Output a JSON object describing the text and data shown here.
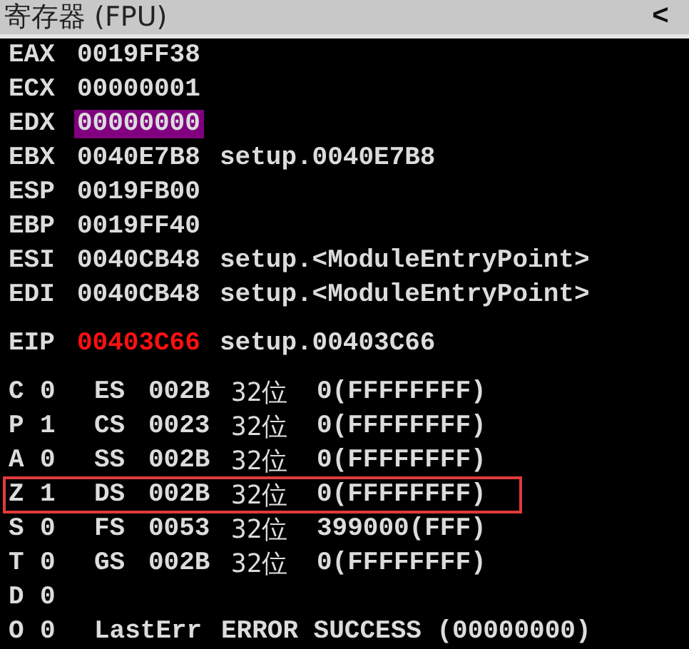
{
  "panel": {
    "title": "寄存器 (FPU)",
    "collapse_button": "<"
  },
  "register_groups": [
    [
      {
        "name": "EAX",
        "value": "0019FF38",
        "selected": false,
        "changed": false
      },
      {
        "name": "ECX",
        "value": "00000001",
        "selected": false,
        "changed": false
      },
      {
        "name": "EDX",
        "value": "00000000",
        "selected": true,
        "changed": false
      },
      {
        "name": "EBX",
        "value": "0040E7B8",
        "comment": "setup.0040E7B8",
        "selected": false,
        "changed": false
      },
      {
        "name": "ESP",
        "value": "0019FB00",
        "selected": false,
        "changed": false
      },
      {
        "name": "EBP",
        "value": "0019FF40",
        "selected": false,
        "changed": false
      },
      {
        "name": "ESI",
        "value": "0040CB48",
        "comment": "setup.<ModuleEntryPoint>",
        "selected": false,
        "changed": false
      },
      {
        "name": "EDI",
        "value": "0040CB48",
        "comment": "setup.<ModuleEntryPoint>",
        "selected": false,
        "changed": false
      }
    ],
    [
      {
        "name": "EIP",
        "value": "00403C66",
        "comment": "setup.00403C66",
        "selected": false,
        "changed": true
      }
    ]
  ],
  "flag_rows": [
    {
      "kind": "segment",
      "flag": "C",
      "value": "0",
      "segment": "ES",
      "selector": "002B",
      "bits": "32位",
      "base": "0(FFFFFFFF)",
      "boxed": false
    },
    {
      "kind": "segment",
      "flag": "P",
      "value": "1",
      "segment": "CS",
      "selector": "0023",
      "bits": "32位",
      "base": "0(FFFFFFFF)",
      "boxed": false
    },
    {
      "kind": "segment",
      "flag": "A",
      "value": "0",
      "segment": "SS",
      "selector": "002B",
      "bits": "32位",
      "base": "0(FFFFFFFF)",
      "boxed": false
    },
    {
      "kind": "segment",
      "flag": "Z",
      "value": "1",
      "segment": "DS",
      "selector": "002B",
      "bits": "32位",
      "base": "0(FFFFFFFF)",
      "boxed": true
    },
    {
      "kind": "segment",
      "flag": "S",
      "value": "0",
      "segment": "FS",
      "selector": "0053",
      "bits": "32位",
      "base": "399000(FFF)",
      "boxed": false
    },
    {
      "kind": "segment",
      "flag": "T",
      "value": "0",
      "segment": "GS",
      "selector": "002B",
      "bits": "32位",
      "base": "0(FFFFFFFF)",
      "boxed": false
    },
    {
      "kind": "plain",
      "flag": "D",
      "value": "0",
      "boxed": false
    },
    {
      "kind": "lasterr",
      "flag": "O",
      "value": "0",
      "label": "LastErr",
      "error": "ERROR SUCCESS (00000000)",
      "boxed": false
    }
  ]
}
